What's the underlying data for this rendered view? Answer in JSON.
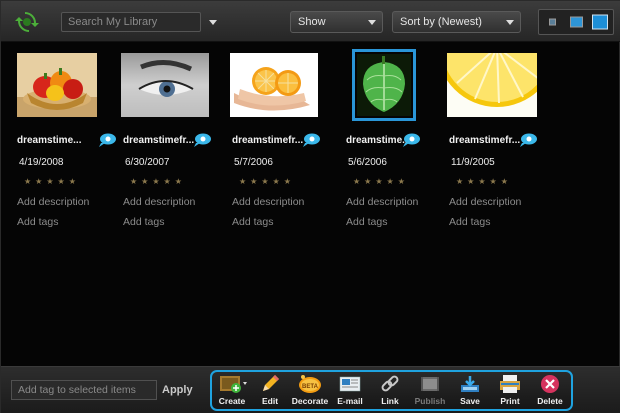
{
  "search": {
    "placeholder": "Search My Library"
  },
  "toolbar": {
    "show_label": "Show",
    "sort_label": "Sort by (Newest)"
  },
  "items": [
    {
      "name": "dreamstime...",
      "date": "4/19/2008",
      "stars": "★★★★★",
      "description": "Add description",
      "tags": "Add tags"
    },
    {
      "name": "dreamstimefr...",
      "date": "6/30/2007",
      "stars": "★★★★★",
      "description": "Add description",
      "tags": "Add tags"
    },
    {
      "name": "dreamstimefr...",
      "date": "5/7/2006",
      "stars": "★★★★★",
      "description": "Add description",
      "tags": "Add tags"
    },
    {
      "name": "dreamstime...",
      "date": "5/6/2006",
      "stars": "★★★★★",
      "description": "Add description",
      "tags": "Add tags"
    },
    {
      "name": "dreamstimefr...",
      "date": "11/9/2005",
      "stars": "★★★★★",
      "description": "Add description",
      "tags": "Add tags"
    }
  ],
  "bottom": {
    "tag_placeholder": "Add tag to selected items",
    "apply_label": "Apply",
    "actions": [
      {
        "label": "Create",
        "icon": "create-icon"
      },
      {
        "label": "Edit",
        "icon": "pencil-icon"
      },
      {
        "label": "Decorate",
        "icon": "beta-decorate-icon"
      },
      {
        "label": "E-mail",
        "icon": "email-icon"
      },
      {
        "label": "Link",
        "icon": "link-icon"
      },
      {
        "label": "Publish",
        "icon": "publish-icon",
        "disabled": true
      },
      {
        "label": "Save",
        "icon": "save-icon"
      },
      {
        "label": "Print",
        "icon": "print-icon"
      },
      {
        "label": "Delete",
        "icon": "delete-icon"
      }
    ]
  },
  "colors": {
    "accent": "#1fa3e0",
    "selection": "#2a96d8",
    "background": "#050505",
    "star": "#8d7a4e"
  }
}
